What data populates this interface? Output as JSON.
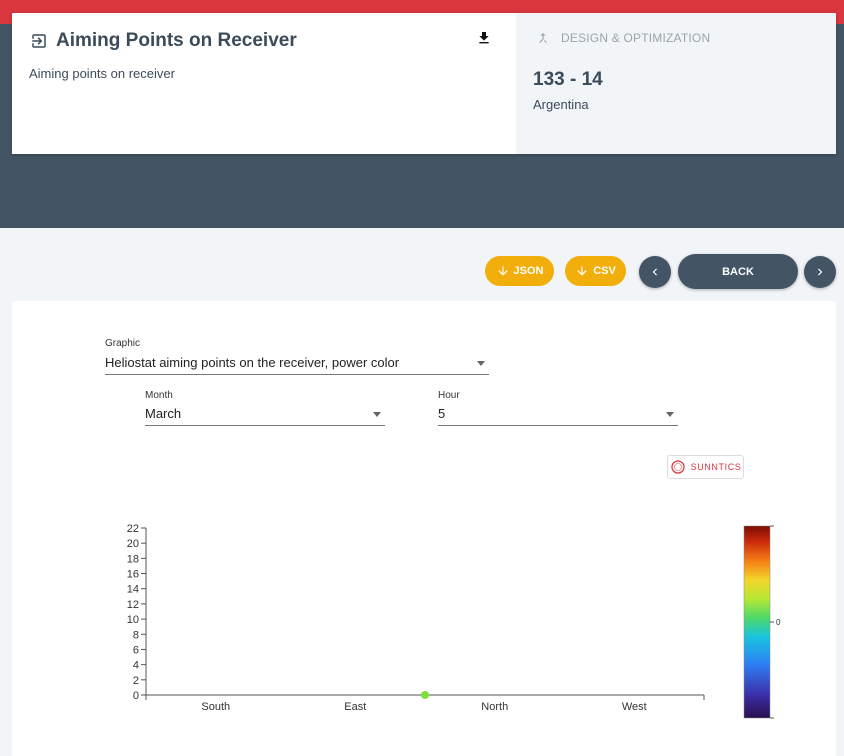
{
  "header": {
    "title": "Aiming Points on Receiver",
    "description": "Aiming points on receiver",
    "category": "DESIGN & OPTIMIZATION",
    "code": "133 - 14",
    "country": "Argentina",
    "title_icon": "exit-to-app-icon",
    "download_icon": "download-icon",
    "category_icon": "merge-icon"
  },
  "toolbar": {
    "json_label": "JSON",
    "csv_label": "CSV",
    "back_label": "BACK"
  },
  "controls": {
    "graphic_label": "Graphic",
    "graphic_value": "Heliostat aiming points on the receiver, power color",
    "month_label": "Month",
    "month_value": "March",
    "hour_label": "Hour",
    "hour_value": "5"
  },
  "logo_text": "SUNNTICS",
  "colors": {
    "top_bar": "#d9363e",
    "dark_band": "#435464",
    "accent": "#f2ae0a",
    "point": "#7ddf3a"
  },
  "chart_data": {
    "type": "scatter",
    "categories": [
      "South",
      "East",
      "North",
      "West"
    ],
    "x_ticks": [
      "South",
      "East",
      "North",
      "West"
    ],
    "y_ticks": [
      0,
      2,
      4,
      6,
      8,
      10,
      12,
      14,
      16,
      18,
      20,
      22
    ],
    "ylim": [
      0,
      22
    ],
    "points": [
      {
        "x": 1.5,
        "y": 0
      }
    ],
    "colorbar": {
      "tick": "0"
    },
    "grid": false
  }
}
